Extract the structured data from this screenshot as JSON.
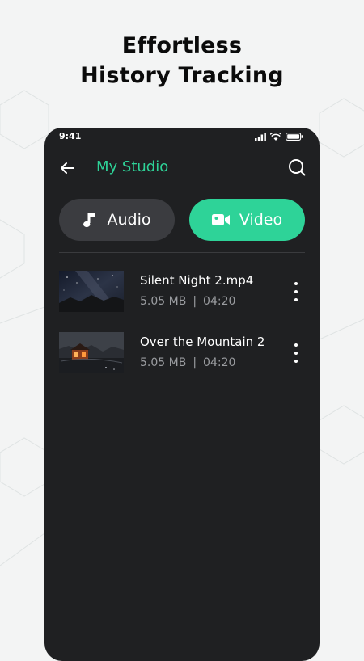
{
  "headline": {
    "line1": "Effortless",
    "line2": "History Tracking"
  },
  "status_bar": {
    "time": "9:41"
  },
  "appbar": {
    "title": "My Studio"
  },
  "tabs": [
    {
      "label": "Audio",
      "icon": "music-note-icon",
      "selected": false
    },
    {
      "label": "Video",
      "icon": "video-camera-icon",
      "selected": true
    }
  ],
  "videos": [
    {
      "title": "Silent Night 2.mp4",
      "size": "5.05 MB",
      "separator": "|",
      "duration": "04:20",
      "thumbnail": "night-sky-thumbnail"
    },
    {
      "title": "Over the Mountain 2",
      "size": "5.05 MB",
      "separator": "|",
      "duration": "04:20",
      "thumbnail": "cabin-night-thumbnail"
    }
  ],
  "colors": {
    "accent": "#2ED398",
    "phone_bg": "#1F2022",
    "tab_inactive": "#3B3C40",
    "page_bg": "#F3F4F4",
    "meta_text": "#9A9CA0"
  }
}
